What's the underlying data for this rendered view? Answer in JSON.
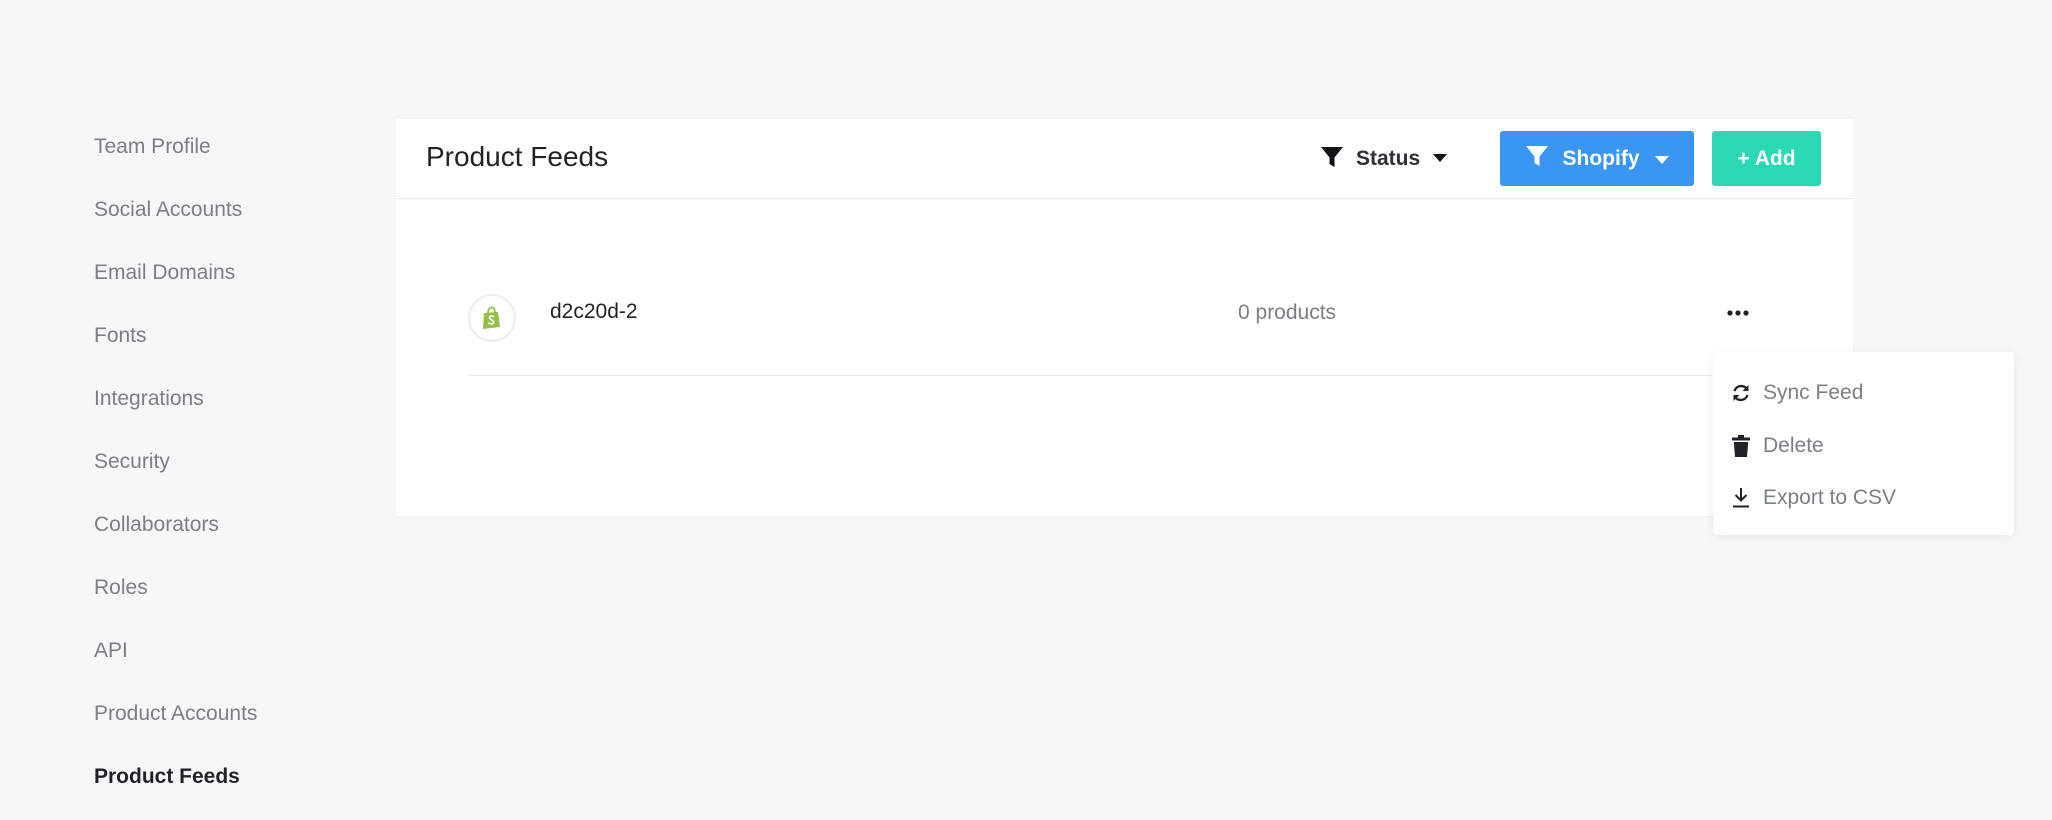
{
  "sidebar": {
    "items": [
      {
        "label": "Team Profile"
      },
      {
        "label": "Social Accounts"
      },
      {
        "label": "Email Domains"
      },
      {
        "label": "Fonts"
      },
      {
        "label": "Integrations"
      },
      {
        "label": "Security"
      },
      {
        "label": "Collaborators"
      },
      {
        "label": "Roles"
      },
      {
        "label": "API"
      },
      {
        "label": "Product Accounts"
      },
      {
        "label": "Product Feeds",
        "active": true
      }
    ]
  },
  "header": {
    "title": "Product Feeds",
    "status_filter_label": "Status",
    "platform_filter_label": "Shopify",
    "add_label": "+ Add"
  },
  "feeds": [
    {
      "name": "d2c20d-2",
      "count": "0 products",
      "logo_icon": "shopify-icon"
    }
  ],
  "menu": {
    "items": [
      {
        "label": "Sync Feed",
        "icon": "sync-icon"
      },
      {
        "label": "Delete",
        "icon": "trash-icon"
      },
      {
        "label": "Export to CSV",
        "icon": "download-icon"
      }
    ]
  },
  "colors": {
    "page_bg": "#f6f7f9",
    "primary_blue": "#3b96f3",
    "add_green": "#2ad8b4",
    "shopify_green": "#95bf47"
  }
}
